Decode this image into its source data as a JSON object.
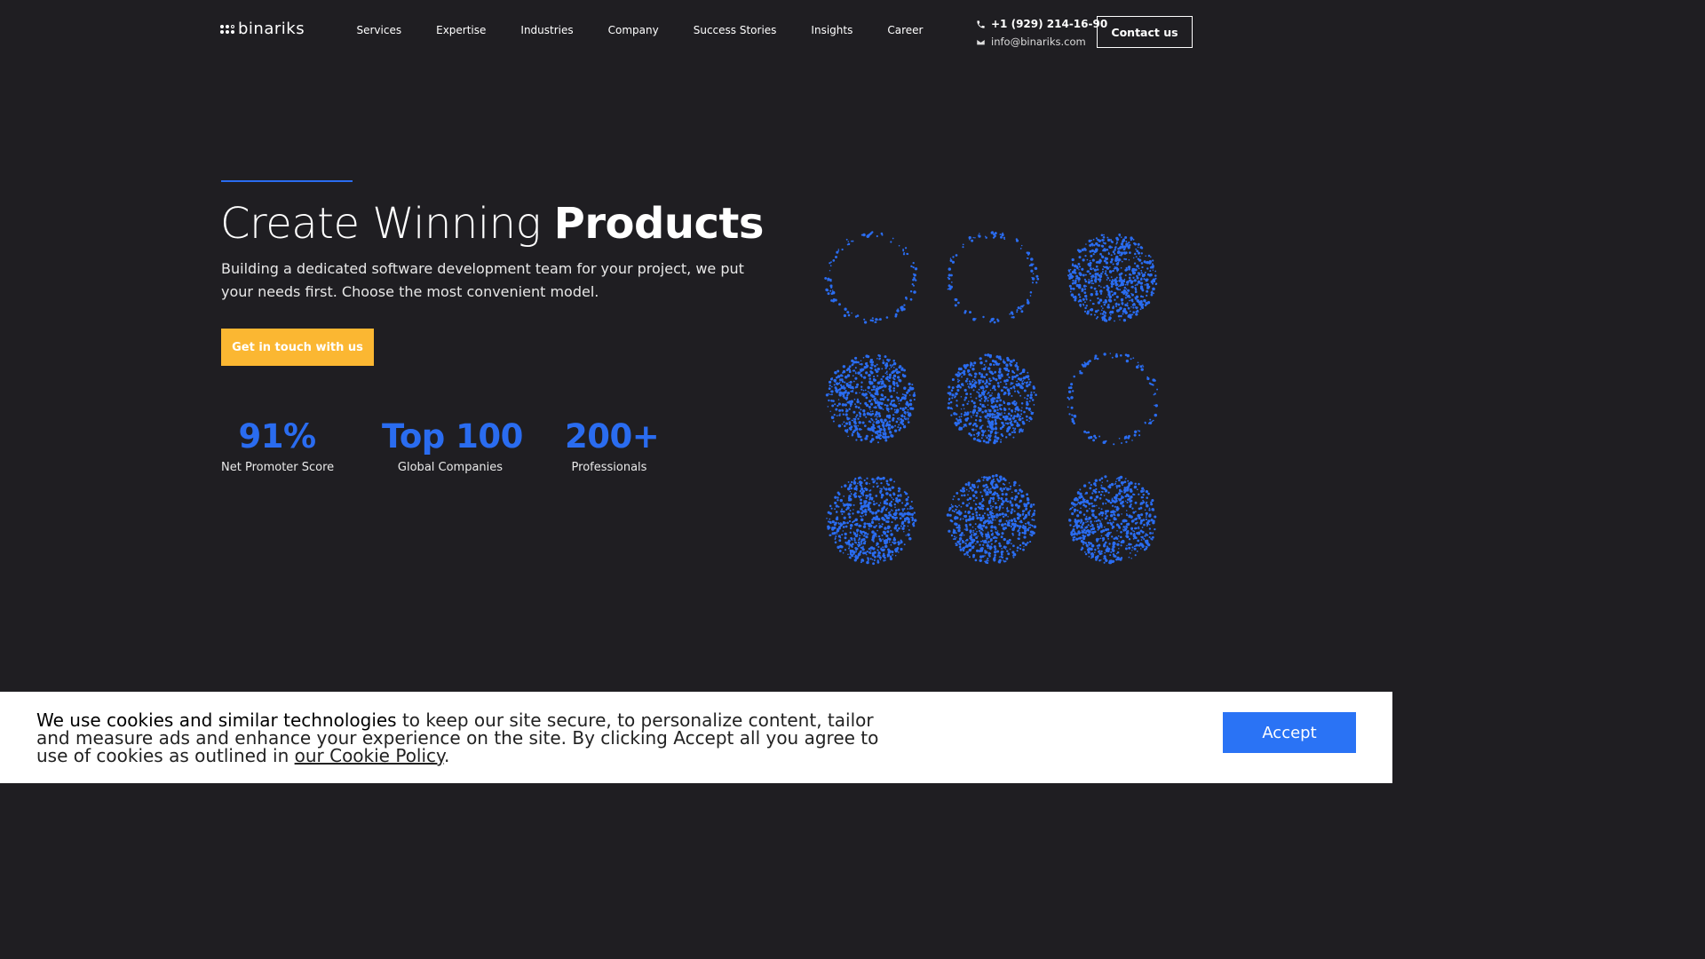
{
  "brand": {
    "name": "binariks"
  },
  "nav": {
    "items": [
      "Services",
      "Expertise",
      "Industries",
      "Company",
      "Success Stories",
      "Insights",
      "Career"
    ]
  },
  "contact": {
    "phone": "+1 (929) 214-16-90",
    "email": "info@binariks.com",
    "button": "Contact us"
  },
  "hero": {
    "title_light": "Create Winning ",
    "title_bold": "Products",
    "subtitle": "Building a dedicated software development team for your project, we put your needs first. Choose the most convenient model.",
    "cta": "Get in touch with us"
  },
  "stats": [
    {
      "value": "91%",
      "label": "Net Promoter Score"
    },
    {
      "value": "Top 100",
      "label": "Global Companies"
    },
    {
      "value": "200+",
      "label": "Professionals"
    }
  ],
  "dot_grid": {
    "color": "#2a6cf0",
    "rows": [
      [
        "ring",
        "ring",
        "filled"
      ],
      [
        "filled",
        "filled",
        "ring"
      ],
      [
        "filled",
        "filled",
        "filled"
      ]
    ]
  },
  "cookie": {
    "lead": "We use cookies and similar technologies",
    "body": " to keep our site secure, to personalize content, tailor and measure ads and enhance your experience on the site. By clicking Accept all you agree to use of cookies as outlined in ",
    "link": "our Cookie Policy",
    "end": ".",
    "accept": "Accept"
  },
  "colors": {
    "background": "#1f1e22",
    "accent_blue": "#2a6cf0",
    "cta_yellow": "#fbb732",
    "accept_blue": "#2a73f5"
  }
}
